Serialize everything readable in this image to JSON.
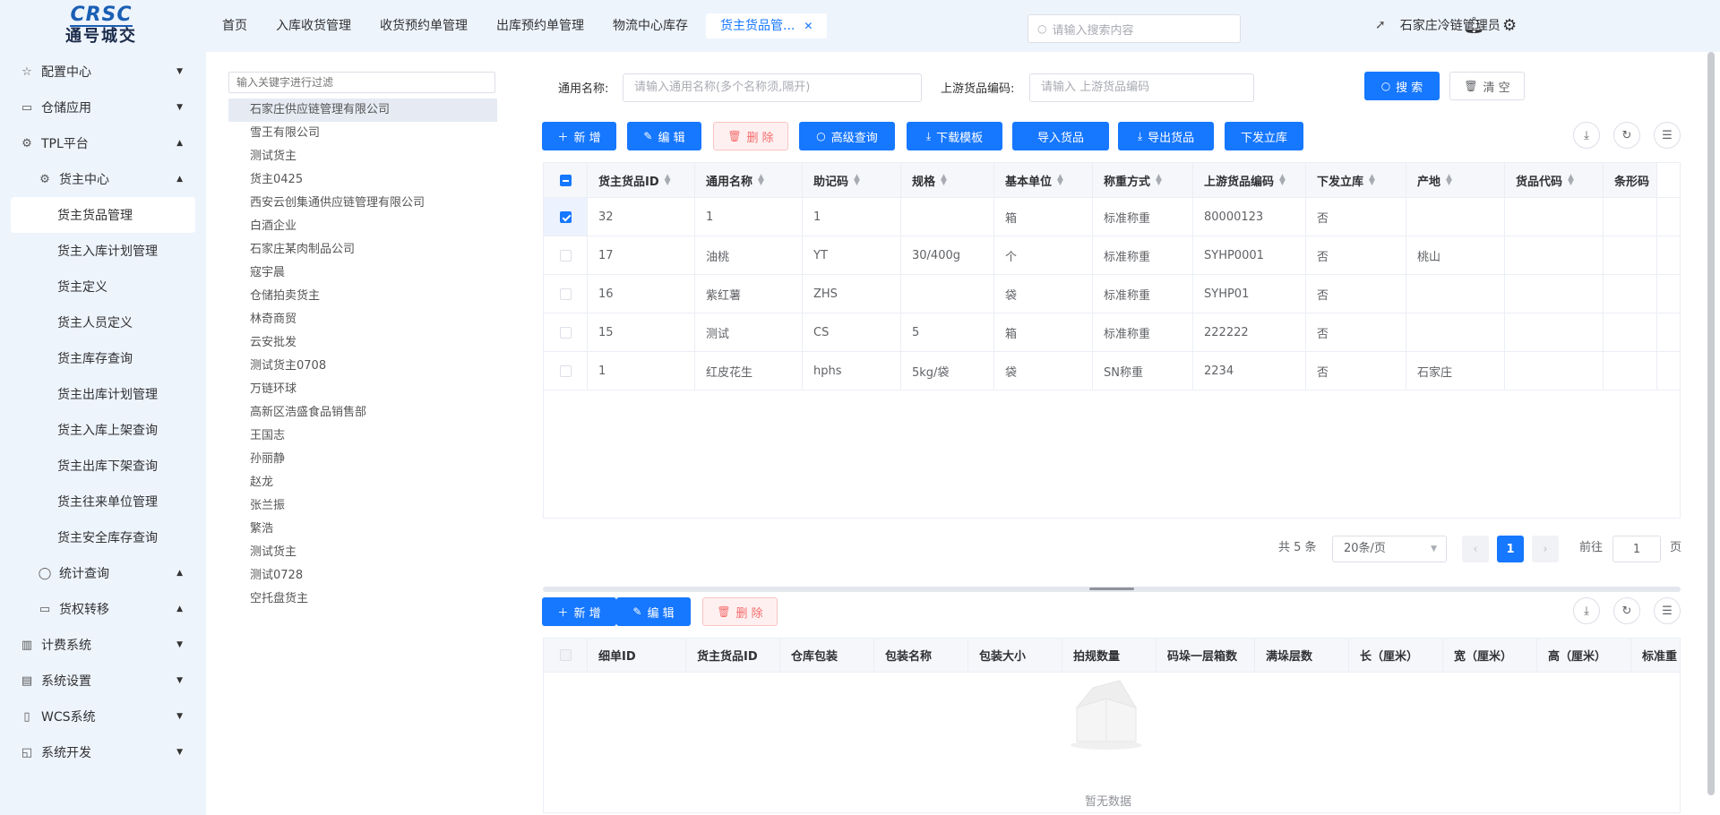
{
  "brand": {
    "logo_en": "CRSC",
    "logo_cn": "通号城交"
  },
  "sidebar": {
    "items": [
      {
        "label": "配置中心",
        "icon": "star-icon"
      },
      {
        "label": "仓储应用",
        "icon": "book-icon"
      },
      {
        "label": "TPL平台",
        "icon": "gear-icon"
      },
      {
        "label": "货主中心",
        "icon": "gear-icon"
      },
      {
        "label": "货主货品管理"
      },
      {
        "label": "货主入库计划管理"
      },
      {
        "label": "货主定义"
      },
      {
        "label": "货主人员定义"
      },
      {
        "label": "货主库存查询"
      },
      {
        "label": "货主出库计划管理"
      },
      {
        "label": "货主入库上架查询"
      },
      {
        "label": "货主出库下架查询"
      },
      {
        "label": "货主往来单位管理"
      },
      {
        "label": "货主安全库存查询"
      },
      {
        "label": "统计查询",
        "icon": "chat-icon"
      },
      {
        "label": "货权转移",
        "icon": "book-icon"
      },
      {
        "label": "计费系统",
        "icon": "bar-chart-icon"
      },
      {
        "label": "系统设置",
        "icon": "server-icon"
      },
      {
        "label": "WCS系统",
        "icon": "device-icon"
      },
      {
        "label": "系统开发",
        "icon": "code-icon"
      }
    ]
  },
  "topbar": {
    "tabs": [
      "首页",
      "入库收货管理",
      "收货预约单管理",
      "出库预约单管理",
      "物流中心库存",
      "货主货品管..."
    ],
    "search_placeholder": "请输入搜索内容",
    "user": "石家庄冷链管理员"
  },
  "tree": {
    "filter_placeholder": "输入关键字进行过滤",
    "items": [
      "石家庄供应链管理有限公司",
      "雪王有限公司",
      "测试货主",
      "货主0425",
      "西安云创集通供应链管理有限公司",
      "白酒企业",
      "石家庄某肉制品公司",
      "寇宇晨",
      "仓储拍卖货主",
      "林奇商贸",
      "云安批发",
      "测试货主0708",
      "万链环球",
      "高新区浩盛食品销售部",
      "王国志",
      "孙丽静",
      "赵龙",
      "张兰振",
      "繁浩",
      "测试货主",
      "测试0728",
      "空托盘货主"
    ]
  },
  "filters": {
    "name_label": "通用名称:",
    "name_placeholder": "请输入通用名称(多个名称须,隔开)",
    "code_label": "上游货品编码:",
    "code_placeholder": "请输入 上游货品编码",
    "search_btn": "搜 索",
    "clear_btn": "清 空"
  },
  "toolbar": {
    "add": "新 增",
    "edit": "编 辑",
    "delete": "删 除",
    "adv_query": "高级查询",
    "download_tpl": "下载模板",
    "import": "导入货品",
    "export": "导出货品",
    "dispatch": "下发立库"
  },
  "main_table": {
    "columns": [
      "货主货品ID",
      "通用名称",
      "助记码",
      "规格",
      "基本单位",
      "称重方式",
      "上游货品编码",
      "下发立库",
      "产地",
      "货品代码",
      "条形码"
    ],
    "rows": [
      [
        "32",
        "1",
        "1",
        "",
        "箱",
        "标准称重",
        "80000123",
        "否",
        "",
        "",
        ""
      ],
      [
        "17",
        "油桃",
        "YT",
        "30/400g",
        "个",
        "标准称重",
        "SYHP0001",
        "否",
        "桃山",
        "",
        ""
      ],
      [
        "16",
        "紫红薯",
        "ZHS",
        "",
        "袋",
        "标准称重",
        "SYHP01",
        "否",
        "",
        "",
        ""
      ],
      [
        "15",
        "测试",
        "CS",
        "5",
        "箱",
        "标准称重",
        "222222",
        "否",
        "",
        "",
        ""
      ],
      [
        "1",
        "红皮花生",
        "hphs",
        "5kg/袋",
        "袋",
        "SN称重",
        "2234",
        "否",
        "石家庄",
        "",
        ""
      ]
    ]
  },
  "pagination": {
    "total": "共 5 条",
    "page_size": "20条/页",
    "current": "1",
    "goto_label": "前往",
    "goto_value": "1",
    "page_unit": "页"
  },
  "detail_toolbar": {
    "add": "新 增",
    "edit": "编 辑",
    "delete": "删 除"
  },
  "detail_table": {
    "columns": [
      "细单ID",
      "货主货品ID",
      "仓库包装",
      "包装名称",
      "包装大小",
      "拍规数量",
      "码垛一层箱数",
      "满垛层数",
      "长（厘米）",
      "宽（厘米）",
      "高（厘米）",
      "标准重"
    ],
    "empty_text": "暂无数据"
  },
  "colors": {
    "primary": "#1677ff",
    "sidebar_bg": "#eef4fc",
    "danger": "#f56c6c"
  }
}
